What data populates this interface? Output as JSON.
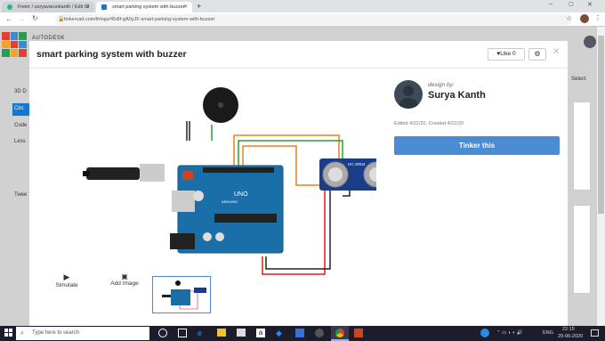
{
  "browser": {
    "tabs": [
      {
        "label": "Fiverr / suryavarunkanth / Edit Gi"
      },
      {
        "label": "smart parking system with buzzer"
      }
    ],
    "url": "tinkercad.com/things/45dIf-gA0yJF-smart-parking-system-with-buzzer"
  },
  "background": {
    "brand": "AUTODESK",
    "logo_letters": [
      "TIN",
      "KER",
      "CAD"
    ],
    "left_items": [
      "3D D",
      "Circ",
      "Code",
      "Less",
      "Twee"
    ],
    "right_text": "Select"
  },
  "modal": {
    "title": "smart parking system with buzzer",
    "like_label": "Like 0",
    "designed_by": "design by:",
    "author": "Surya Kanth",
    "edited": "Edited 4/22/20, Created 4/22/20",
    "tinker_button": "Tinker this",
    "tools": {
      "simulate": "Simulate",
      "add_image": "Add Image"
    }
  },
  "circuit_labels": {
    "board": "UNO",
    "brand": "ARDUINO",
    "sensor": "HC-SR04"
  },
  "taskbar": {
    "search_placeholder": "Type here to search",
    "lang": "ENG",
    "time": "22:15",
    "date": "29-06-2020"
  },
  "colors": {
    "accent": "#4a8bd4",
    "board": "#1a6fa8",
    "taskbar": "#1c1c2a"
  }
}
